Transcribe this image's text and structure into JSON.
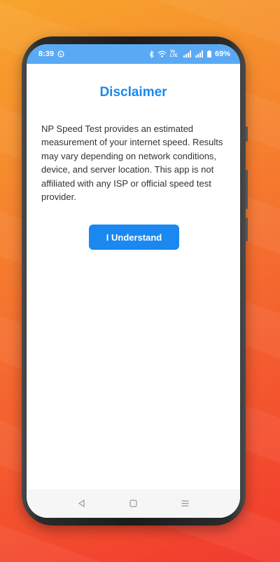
{
  "status_bar": {
    "time": "8:39",
    "battery": "69%",
    "network_label": "Vo LTE",
    "icons": [
      "whatsapp-icon",
      "bluetooth-icon",
      "wifi-icon",
      "signal-icon",
      "signal-icon",
      "battery-icon"
    ]
  },
  "dialog": {
    "title": "Disclaimer",
    "message": "NP Speed Test provides an estimated measurement of your internet speed. Results may vary depending on network conditions, device, and server location. This app is not affiliated with any ISP or official speed test provider.",
    "confirm_label": "I Understand"
  },
  "nav_bar": {
    "keys": [
      "back-icon",
      "home-icon",
      "recents-icon"
    ]
  },
  "colors": {
    "accent": "#1a88f0",
    "status_bar": "#5aa9f4",
    "background_top": "#f7a52c",
    "background_bottom": "#f23a2e"
  }
}
